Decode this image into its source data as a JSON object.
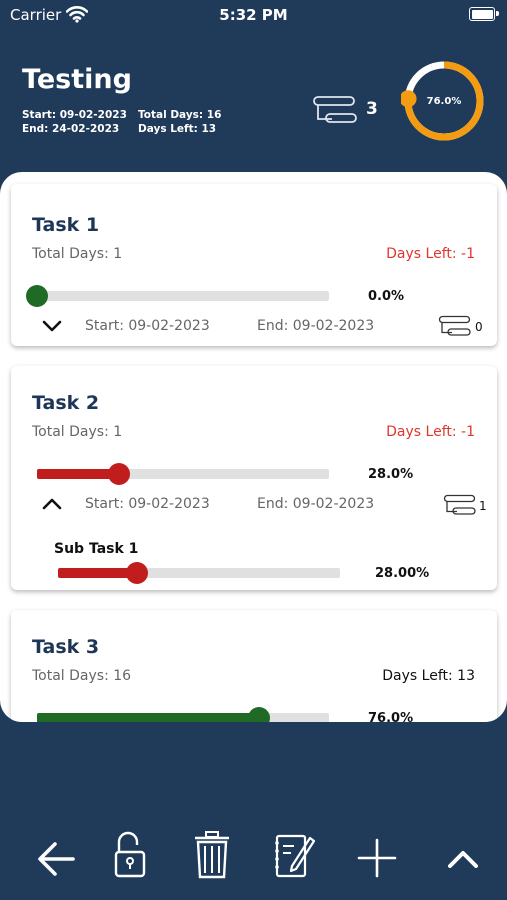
{
  "status_bar": {
    "carrier": "Carrier",
    "time": "5:32 PM"
  },
  "project": {
    "title": "Testing",
    "start_label": "Start: 09-02-2023",
    "total_days_label": "Total Days: 16",
    "end_label": "End:  24-02-2023",
    "days_left_label": "Days Left: 13",
    "subtask_count": "3",
    "progress_label": "76.0%",
    "progress": 0.76
  },
  "tasks": [
    {
      "title": "Task 1",
      "total_days": "Total Days: 1",
      "days_left": "Days Left: -1",
      "progress": 0.0,
      "progress_label": "0.0%",
      "start": "Start: 09-02-2023",
      "end": "End: 09-02-2023",
      "subtask_count": "0",
      "color": "#1f6b26"
    },
    {
      "title": "Task 2",
      "total_days": "Total Days: 1",
      "days_left": "Days Left: -1",
      "progress": 0.28,
      "progress_label": "28.0%",
      "start": "Start: 09-02-2023",
      "end": "End: 09-02-2023",
      "subtask_count": "1",
      "color": "#c21d1d",
      "subtask": {
        "title": "Sub Task 1",
        "progress": 0.28,
        "progress_label": "28.00%"
      }
    },
    {
      "title": "Task 3",
      "total_days": "Total Days: 16",
      "days_left": "Days Left: 13",
      "progress": 0.76,
      "progress_label": "76.0%",
      "color": "#1f6b26"
    }
  ],
  "colors": {
    "background": "#203a5a",
    "accent": "#f39c12",
    "danger": "#e0362c"
  },
  "toolbar_icons": [
    "back-arrow-icon",
    "unlock-icon",
    "trash-icon",
    "edit-note-icon",
    "plus-icon",
    "chevron-up-icon"
  ]
}
